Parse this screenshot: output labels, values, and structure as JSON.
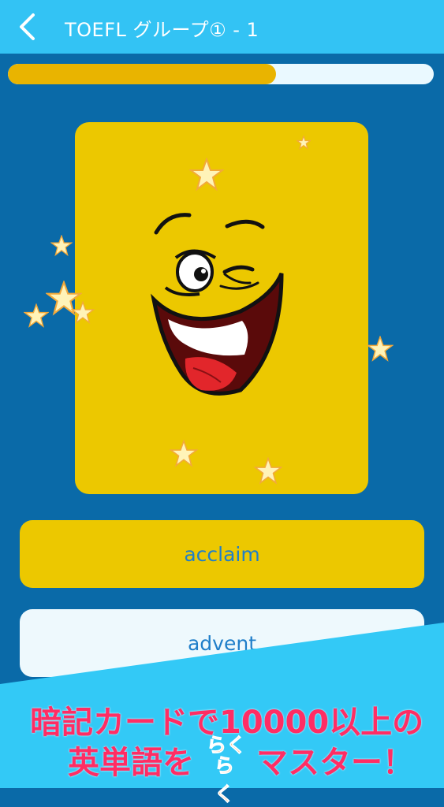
{
  "header": {
    "title": "TOEFL グループ① - 1",
    "back_icon": "chevron-left-icon"
  },
  "progress": {
    "value_percent": 63,
    "fill_color": "#e9b400",
    "track_color": "#eaf9ff"
  },
  "card": {
    "image": "winking-smiley-face-with-stars",
    "background_color": "#ecc800"
  },
  "choices": [
    {
      "label": "acclaim"
    },
    {
      "label": "advent"
    }
  ],
  "promo": {
    "line1": "暗記カードで10000以上の",
    "line2_start": "英単語を",
    "rakuraku_top": "らく",
    "rakuraku_bottom": "らく",
    "line2_end": "マスター！"
  },
  "colors": {
    "header_bg": "#33c3f4",
    "page_bg": "#0a6aa8",
    "promo_text": "#ff2d64",
    "choice_text": "#1f7ec9"
  }
}
